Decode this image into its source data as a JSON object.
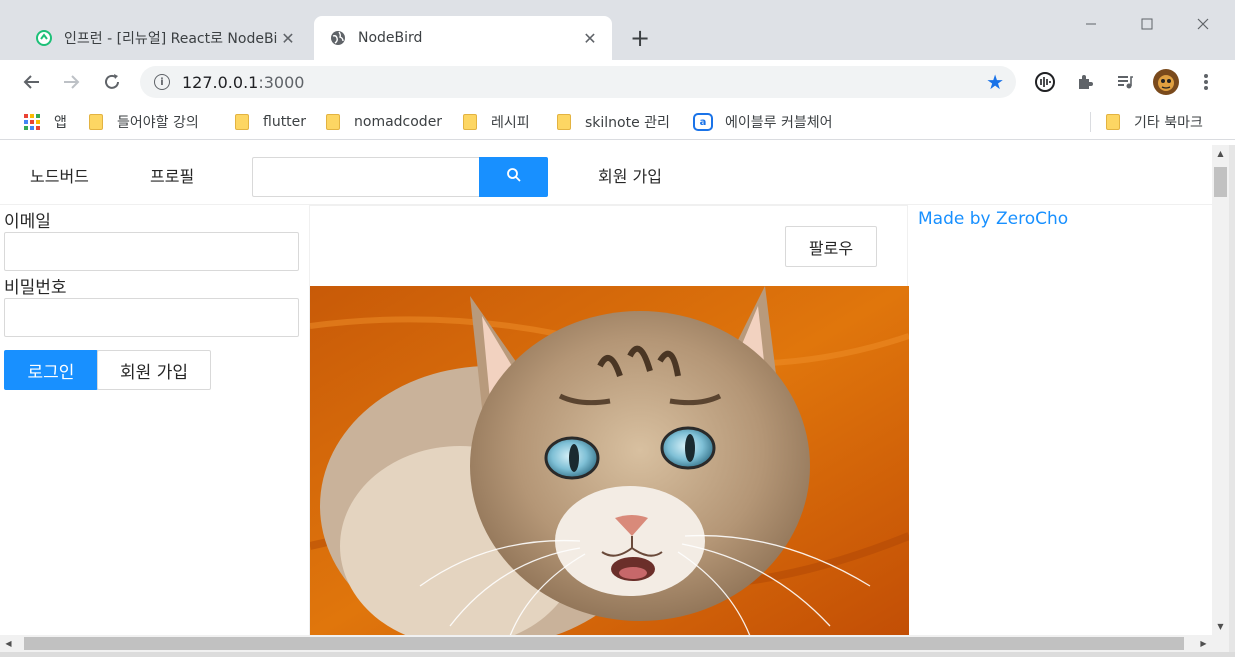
{
  "browser": {
    "tabs": [
      {
        "title": "인프런 - [리뉴얼] React로 NodeBird SNS 만들기",
        "active": false
      },
      {
        "title": "NodeBird",
        "active": true
      }
    ],
    "new_tab_label": "+",
    "url_host": "127.0.0.1",
    "url_port": ":3000",
    "bookmarks": [
      {
        "label": "앱",
        "type": "apps"
      },
      {
        "label": "들어야할 강의",
        "type": "folder"
      },
      {
        "label": "flutter",
        "type": "folder"
      },
      {
        "label": "nomadcoder",
        "type": "folder"
      },
      {
        "label": "레시피",
        "type": "folder"
      },
      {
        "label": "skilnote 관리",
        "type": "folder"
      },
      {
        "label": "에이블루 커블체어",
        "type": "site"
      }
    ],
    "other_bookmarks": "기타 북마크"
  },
  "menu": {
    "home": "노드버드",
    "profile": "프로필",
    "search_value": "",
    "signup": "회원 가입"
  },
  "login_form": {
    "email_label": "이메일",
    "email_value": "",
    "password_label": "비밀번호",
    "password_value": "",
    "login_button": "로그인",
    "signup_button": "회원 가입"
  },
  "post": {
    "follow_button": "팔로우"
  },
  "sidebar": {
    "credit": "Made by ZeroCho"
  },
  "colors": {
    "primary": "#1890ff",
    "chrome_bg": "#dee1e6",
    "star": "#1a73e8"
  }
}
